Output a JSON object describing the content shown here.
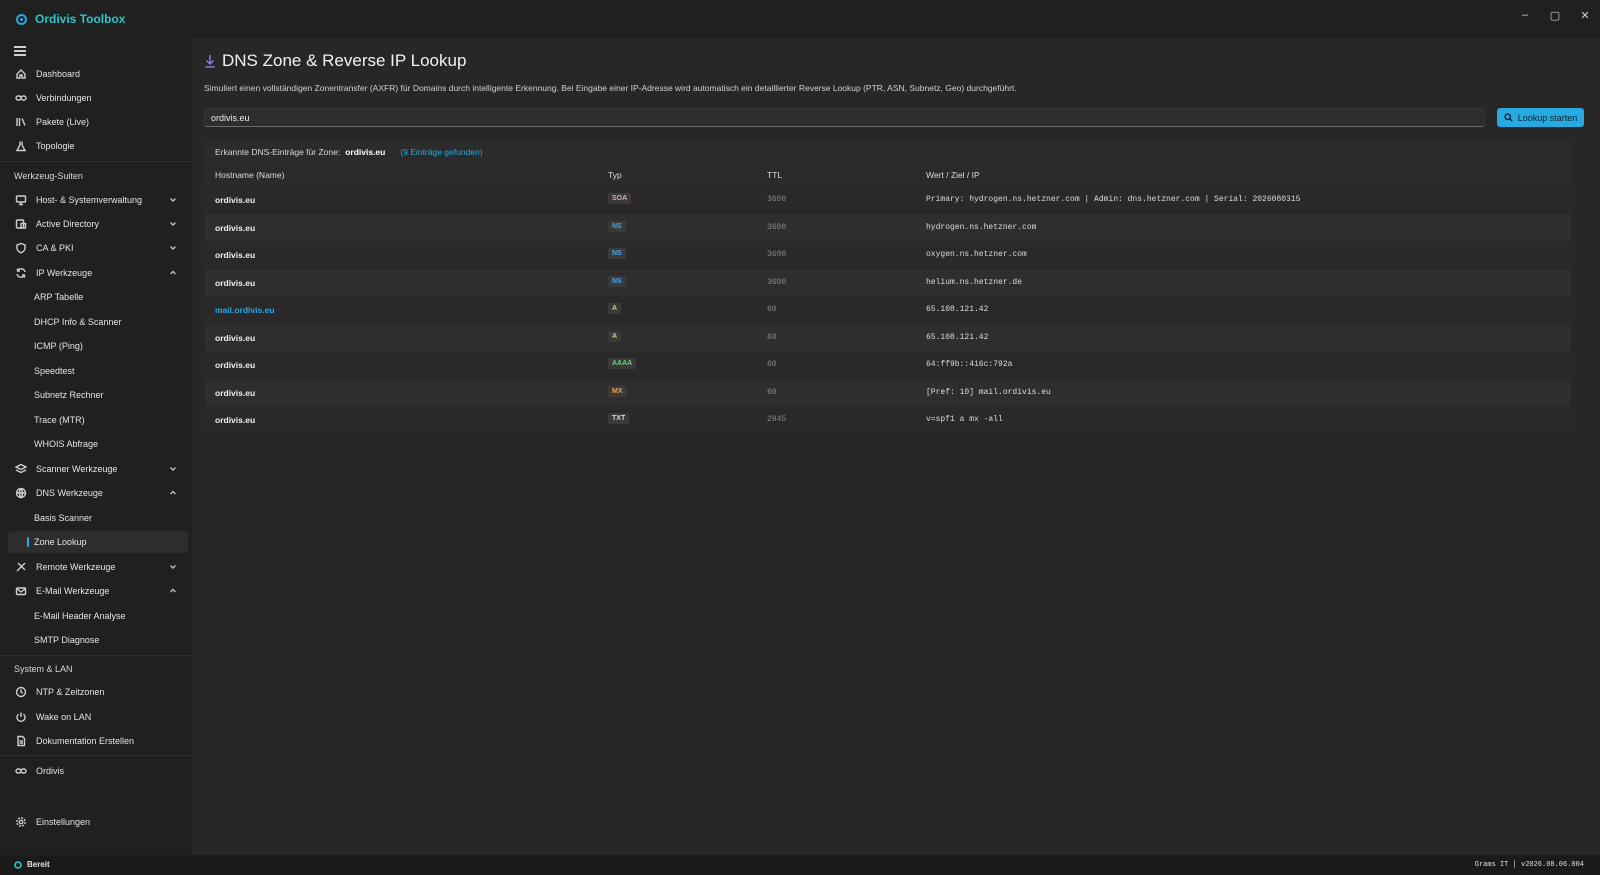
{
  "app": {
    "title": "Ordivis Toolbox"
  },
  "window_controls": {
    "minimize": "–",
    "maximize": "▢",
    "close": "✕"
  },
  "sidebar": {
    "top_items": [
      {
        "label": "Dashboard",
        "icon": "home-icon"
      },
      {
        "label": "Verbindungen",
        "icon": "link-icon"
      },
      {
        "label": "Pakete (Live)",
        "icon": "library-icon"
      },
      {
        "label": "Topologie",
        "icon": "flask-icon"
      }
    ],
    "section_tools": "Werkzeug-Suiten",
    "groups": [
      {
        "label": "Host- & Systemverwaltung",
        "icon": "monitor-icon",
        "expanded": false
      },
      {
        "label": "Active Directory",
        "icon": "directory-icon",
        "expanded": false
      },
      {
        "label": "CA & PKI",
        "icon": "shield-icon",
        "expanded": false
      },
      {
        "label": "IP Werkzeuge",
        "icon": "refresh-icon",
        "expanded": true,
        "children": [
          "ARP Tabelle",
          "DHCP Info & Scanner",
          "ICMP (Ping)",
          "Speedtest",
          "Subnetz Rechner",
          "Trace (MTR)",
          "WHOIS Abfrage"
        ]
      },
      {
        "label": "Scanner Werkzeuge",
        "icon": "layers-icon",
        "expanded": false
      },
      {
        "label": "DNS Werkzeuge",
        "icon": "globe-icon",
        "expanded": true,
        "children": [
          "Basis Scanner",
          "Zone Lookup"
        ],
        "active_child": "Zone Lookup"
      },
      {
        "label": "Remote Werkzeuge",
        "icon": "remote-icon",
        "expanded": false
      },
      {
        "label": "E-Mail Werkzeuge",
        "icon": "mail-icon",
        "expanded": true,
        "children": [
          "E-Mail Header Analyse",
          "SMTP Diagnose"
        ]
      }
    ],
    "section_system": "System & LAN",
    "system_items": [
      {
        "label": "NTP & Zeitzonen",
        "icon": "clock-icon"
      },
      {
        "label": "Wake on LAN",
        "icon": "power-icon"
      },
      {
        "label": "Dokumentation Erstellen",
        "icon": "document-icon"
      }
    ],
    "ordivis_item": {
      "label": "Ordivis",
      "icon": "link-icon"
    },
    "settings_item": {
      "label": "Einstellungen",
      "icon": "gear-icon"
    }
  },
  "main": {
    "title": "DNS Zone & Reverse IP Lookup",
    "description": "Simuliert einen vollständigen Zonentransfer (AXFR) für Domains durch intelligente Erkennung. Bei Eingabe einer IP-Adresse wird automatisch ein detaillierter Reverse Lookup (PTR, ASN, Subnetz, Geo) durchgeführt.",
    "search": {
      "value": "ordivis.eu"
    },
    "lookup_button": "Lookup starten",
    "results": {
      "header_prefix": "Erkannte DNS-Einträge für Zone:",
      "zone": "ordivis.eu",
      "count": "(9 Einträge gefunden)",
      "columns": [
        "Hostname (Name)",
        "Typ",
        "TTL",
        "Wert / Ziel / IP"
      ],
      "rows": [
        {
          "host": "ordivis.eu",
          "type": "SOA",
          "ttl": "3600",
          "value": "Primary: hydrogen.ns.hetzner.com | Admin: dns.hetzner.com | Serial: 2026080315",
          "link": false
        },
        {
          "host": "ordivis.eu",
          "type": "NS",
          "ttl": "3600",
          "value": "hydrogen.ns.hetzner.com",
          "link": false
        },
        {
          "host": "ordivis.eu",
          "type": "NS",
          "ttl": "3600",
          "value": "oxygen.ns.hetzner.com",
          "link": false
        },
        {
          "host": "ordivis.eu",
          "type": "NS",
          "ttl": "3600",
          "value": "helium.ns.hetzner.de",
          "link": false
        },
        {
          "host": "mail.ordivis.eu",
          "type": "A",
          "ttl": "60",
          "value": "65.108.121.42",
          "link": true
        },
        {
          "host": "ordivis.eu",
          "type": "A",
          "ttl": "60",
          "value": "65.108.121.42",
          "link": false
        },
        {
          "host": "ordivis.eu",
          "type": "AAAA",
          "ttl": "60",
          "value": "64:ff9b::416c:792a",
          "link": false
        },
        {
          "host": "ordivis.eu",
          "type": "MX",
          "ttl": "60",
          "value": "[Pref: 10] mail.ordivis.eu",
          "link": false
        },
        {
          "host": "ordivis.eu",
          "type": "TXT",
          "ttl": "2945",
          "value": "v=spf1 a mx -all",
          "link": false
        }
      ]
    }
  },
  "badge_colors": {
    "SOA": "#e9a0a8",
    "NS": "#4aa8e8",
    "A": "#c9d36a",
    "AAAA": "#6ad37a",
    "MX": "#e9a44a",
    "TXT": "#d8d8d8"
  },
  "statusbar": {
    "status": "Bereit",
    "right": "Grams IT | v2026.08.06.004"
  }
}
